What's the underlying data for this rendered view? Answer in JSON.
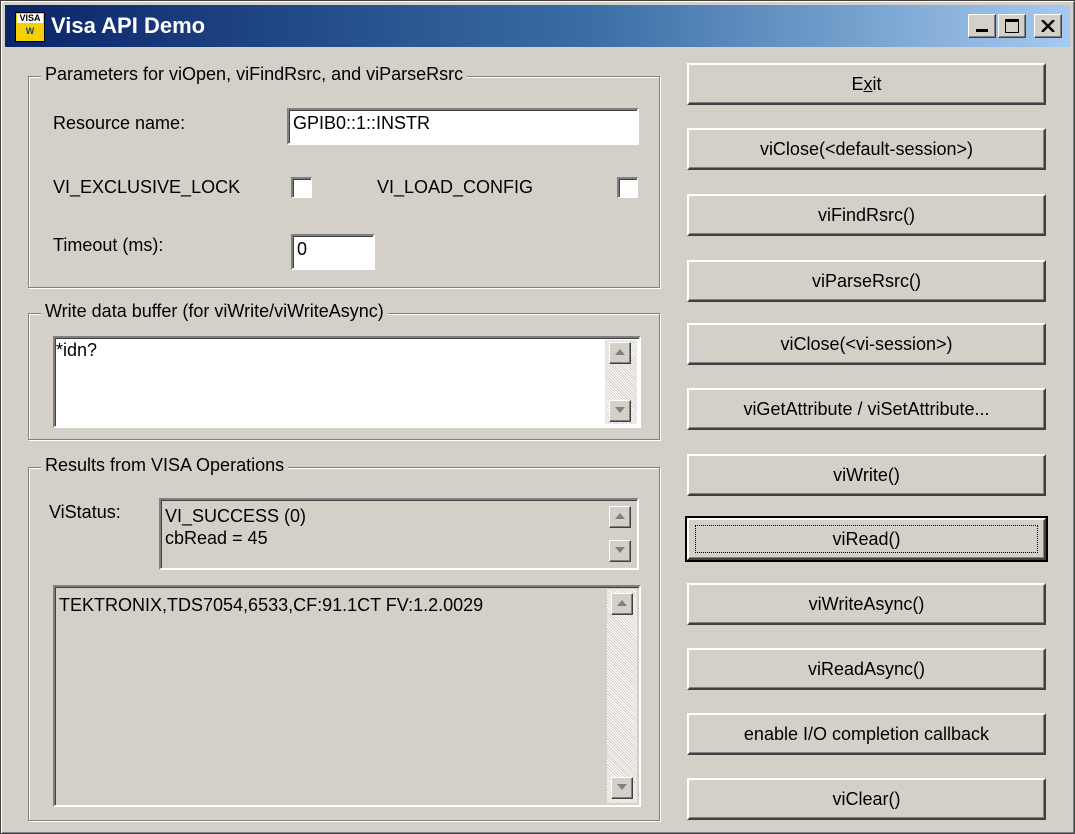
{
  "window": {
    "title": "Visa API Demo",
    "icon_top": "VISA",
    "icon_bottom": "W"
  },
  "params": {
    "legend": "Parameters for viOpen, viFindRsrc, and viParseRsrc",
    "resource_label": "Resource name:",
    "resource_value": "GPIB0::1::INSTR",
    "exclusive_lock_label": "VI_EXCLUSIVE_LOCK",
    "exclusive_lock_checked": false,
    "load_config_label": "VI_LOAD_CONFIG",
    "load_config_checked": false,
    "timeout_label": "Timeout (ms):",
    "timeout_value": "0"
  },
  "write_buffer": {
    "legend": "Write data buffer (for viWrite/viWriteAsync)",
    "value": "*idn?"
  },
  "results": {
    "legend": "Results from VISA Operations",
    "status_label": "ViStatus:",
    "status_line1": "VI_SUCCESS (0)",
    "status_line2": "cbRead = 45",
    "output": "TEKTRONIX,TDS7054,6533,CF:91.1CT FV:1.2.0029"
  },
  "buttons": {
    "exit_pre": "E",
    "exit_u": "x",
    "exit_post": "it",
    "close_default": "viClose(<default-session>)",
    "find_rsrc": "viFindRsrc()",
    "parse_rsrc": "viParseRsrc()",
    "close_session": "viClose(<vi-session>)",
    "get_set_attr": "viGetAttribute / viSetAttribute...",
    "write": "viWrite()",
    "read": "viRead()",
    "write_async": "viWriteAsync()",
    "read_async": "viReadAsync()",
    "enable_callback": "enable I/O completion callback",
    "clear": "viClear()"
  },
  "icons": {
    "minimize": "minimize-icon",
    "maximize": "maximize-icon",
    "close": "close-icon",
    "scroll_up": "scroll-up-arrow-icon",
    "scroll_down": "scroll-down-arrow-icon"
  },
  "colors": {
    "face": "#d4d0c8",
    "title_start": "#0a246a",
    "title_end": "#a6caf0"
  }
}
